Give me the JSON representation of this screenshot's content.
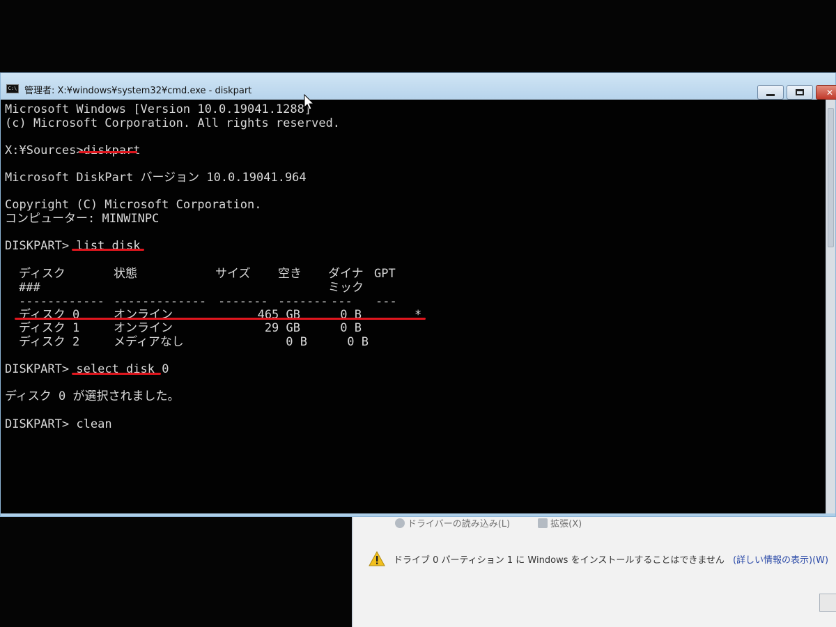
{
  "window": {
    "title": "管理者: X:¥windows¥system32¥cmd.exe - diskpart",
    "icon": "cmd-icon",
    "buttons": [
      "minimize",
      "maximize",
      "close"
    ]
  },
  "console": {
    "header_line1": "Microsoft Windows [Version 10.0.19041.1288]",
    "header_line2": "(c) Microsoft Corporation. All rights reserved.",
    "prompt1": "X:¥Sources>",
    "cmd1": "diskpart",
    "diskpart_version": "Microsoft DiskPart バージョン 10.0.19041.964",
    "copyright": "Copyright (C) Microsoft Corporation.",
    "computer": "コンピューター: MINWINPC",
    "prompt2": "DISKPART>",
    "cmd2": "list disk",
    "table": {
      "headers": {
        "disk": "ディスク",
        "disk_sub": "###",
        "status": "状態",
        "size": "サイズ",
        "free": "空き",
        "dyn": "ダイナ",
        "dyn_sub": "ミック",
        "gpt": "GPT"
      },
      "separators": {
        "disk": "------------",
        "status": "-------------",
        "size": "-------",
        "free": "-------",
        "dyn": "---",
        "gpt": "---"
      },
      "rows": [
        {
          "disk": "ディスク 0",
          "status": "オンライン",
          "size": "465 GB",
          "free": "0 B",
          "dyn": "",
          "gpt": "*"
        },
        {
          "disk": "ディスク 1",
          "status": "オンライン",
          "size": "29 GB",
          "free": "0 B",
          "dyn": "",
          "gpt": ""
        },
        {
          "disk": "ディスク 2",
          "status": "メディアなし",
          "size": "0 B",
          "free": "0 B",
          "dyn": "",
          "gpt": ""
        }
      ]
    },
    "prompt3": "DISKPART>",
    "cmd3": "select disk 0",
    "selected_msg": "ディスク 0 が選択されました。",
    "prompt4": "DISKPART>",
    "cmd4": "clean"
  },
  "setup": {
    "link_driver": "ドライバーの読み込み(L)",
    "link_extend": "拡張(X)",
    "warning_text": "ドライブ 0 パーティション 1 に Windows をインストールすることはできません",
    "warning_link": "(詳しい情報の表示)(W)"
  },
  "colors": {
    "console_bg": "#020202",
    "console_text": "#d8d8d8",
    "annotation_red": "#e0161e",
    "titlebar": "#b7d4ec"
  }
}
